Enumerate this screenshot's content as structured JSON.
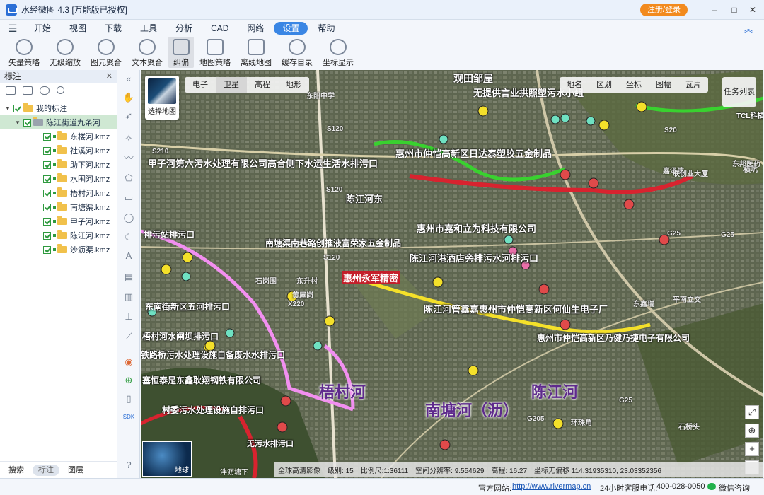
{
  "app": {
    "title": "水经微图 4.3 [万能版已授权]",
    "login_label": "注册/登录",
    "minimize": "–",
    "maximize": "□",
    "close": "✕"
  },
  "menu": {
    "items": [
      "开始",
      "视图",
      "下载",
      "工具",
      "分析",
      "CAD",
      "网络",
      "设置",
      "帮助"
    ],
    "active": "设置"
  },
  "toolbar": {
    "tools": [
      "矢量策略",
      "无级缩放",
      "图元聚合",
      "文本聚合",
      "纠偏",
      "地图策略",
      "离线地图",
      "缓存目录",
      "坐标显示"
    ],
    "active": "纠偏"
  },
  "panel": {
    "title": "标注",
    "root_label": "我的标注",
    "group_label": "陈江街道九条河",
    "files": [
      "东楼河.kmz",
      "社溪河.kmz",
      "助下河.kmz",
      "水围河.kmz",
      "梧村河.kmz",
      "南塘渠.kmz",
      "甲子河.kmz",
      "陈江河.kmz",
      "沙沥渠.kmz"
    ],
    "tabs": [
      "搜索",
      "标注",
      "图层"
    ],
    "active_tab": "标注"
  },
  "map": {
    "layer_thumb_label": "选择地图",
    "tabs_left": [
      "电子",
      "卫星",
      "高程",
      "地形"
    ],
    "active_tab": "卫星",
    "tabs_right": [
      "地名",
      "区划",
      "坐标",
      "图幅",
      "瓦片"
    ],
    "task_button": "任务列表",
    "globe_label": "地球",
    "scale_label": "泮沥塘下",
    "big_labels": [
      "梧村河",
      "南塘河（沥）",
      "陈江河"
    ],
    "red_label": "惠州永军精密",
    "place_labels": [
      "观田邹屋",
      "无提供言业拱照塑污水小组",
      "TCL科技",
      "甲子河第六污水处理有限公司高合侧下水运生活水排污口",
      "惠州市仲恺高新区日达泰塑胶五金制品",
      "陈江河东",
      "惠州市嘉和立为科技有限公司",
      "南塘渠南巷路创推液富荣家五金制品",
      "陈江河港酒店旁排污水河排污口",
      "惠州永军精密",
      "陈江河管鑫嘉惠州市仲恺高新区何仙生电子厂",
      "惠州市仲恺高新区乃健乃捷电子有限公司",
      "塞恒泰是东鑫耿翔钢铁有限公司",
      "排污站排污口",
      "东南街新区五河排污口",
      "梧村河水闸坝排污口",
      "铁路桥污水处理设施自备废水水排污口",
      "村委污水处理设施自排污口",
      "无污水排污口"
    ],
    "road_labels": [
      "S120",
      "S120",
      "S120",
      "S210",
      "G25",
      "G25",
      "G25",
      "S20",
      "G205",
      "X220"
    ],
    "misc_labels": [
      "东阳中学",
      "东升村",
      "石岗围",
      "黄屋岗",
      "环珠角",
      "平南立交",
      "东鑫瑞",
      "石桥头",
      "嘉泽建",
      "横坑",
      "联创业大厦",
      "东邦医药"
    ]
  },
  "status": {
    "source": "全球高清影像",
    "level_label": "级别:",
    "level": "15",
    "scale_label": "比例尺:",
    "scale": "1:36111",
    "resolution_label": "空间分辨率:",
    "resolution": "9.554629",
    "elevation_label": "高程:",
    "elevation": "16.27",
    "coord_label": "坐标无偏移 ",
    "coordinates": "114.31935310, 23.03352356"
  },
  "footer": {
    "website_label": "官方网站:",
    "website": "http://www.rivermap.cn",
    "hotline_label": "24小时客服电话:",
    "hotline": "400-028-0050",
    "wechat": "微信咨询"
  },
  "colors": {
    "accent": "#3a86e4",
    "login": "#f28a1e",
    "river_pink": "#f28ff0",
    "river_green": "#39d12f",
    "river_red": "#d8232f",
    "pin_yellow": "#f4e02a",
    "pin_red": "#e04a4a",
    "pin_teal": "#6fe1c2"
  }
}
